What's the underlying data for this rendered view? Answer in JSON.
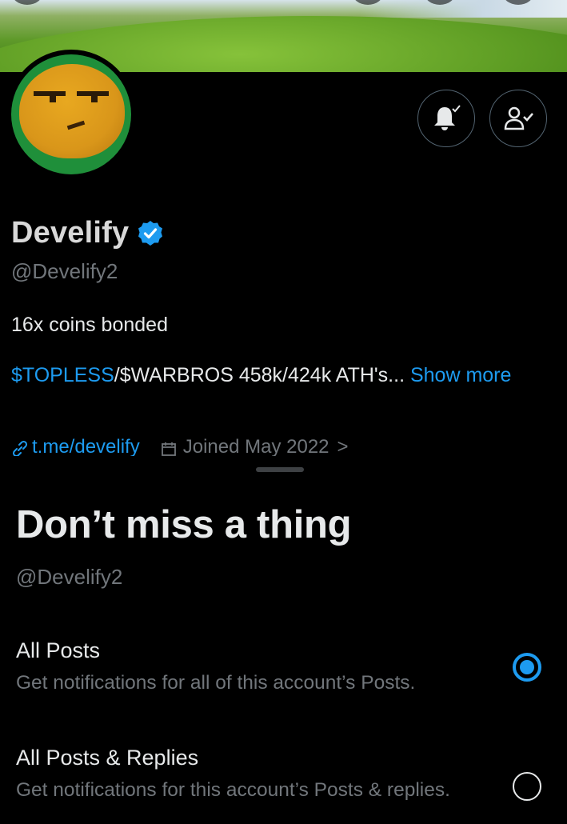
{
  "profile": {
    "name": "Develify",
    "handle": "@Develify2",
    "bio": "16x coins bonded",
    "bio_line2_link": "$TOPLESS",
    "bio_line2_text": "/$WARBROS 458k/424k ATH's...",
    "show_more": "Show more",
    "website": "t.me/develify",
    "joined": "Joined May 2022",
    "joined_chevron": ">"
  },
  "actions": {
    "notifications_icon": "bell-check-icon",
    "following_icon": "person-check-icon"
  },
  "sheet": {
    "title": "Don’t miss a thing",
    "handle": "@Develify2",
    "options": [
      {
        "title": "All Posts",
        "description": "Get notifications for all of this account’s Posts.",
        "selected": true
      },
      {
        "title": "All Posts & Replies",
        "description": "Get notifications for this account’s Posts & replies.",
        "selected": false
      }
    ]
  },
  "colors": {
    "accent": "#1d9bf0",
    "background": "#000000",
    "secondary_text": "#71767b"
  }
}
